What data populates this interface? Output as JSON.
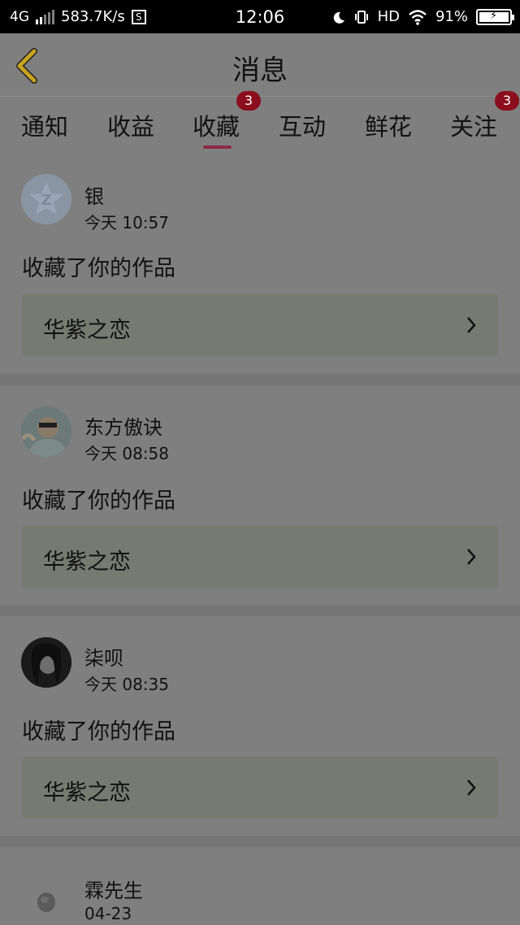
{
  "status_bar": {
    "network": "4G",
    "speed": "583.7K/s",
    "speed_icon": "S",
    "time": "12:06",
    "hd": "HD",
    "battery": "91%"
  },
  "header": {
    "title": "消息",
    "back_icon": "chevron-left-icon"
  },
  "tabs": [
    {
      "label": "通知"
    },
    {
      "label": "收益"
    },
    {
      "label": "收藏",
      "active": true,
      "badge": "3"
    },
    {
      "label": "互动"
    },
    {
      "label": "鲜花"
    },
    {
      "label": "关注",
      "badge": "3"
    }
  ],
  "messages": [
    {
      "user": "银",
      "time": "今天 10:57",
      "action": "收藏了你的作品",
      "work": "华紫之恋"
    },
    {
      "user": "东方傲诀",
      "time": "今天 08:58",
      "action": "收藏了你的作品",
      "work": "华紫之恋"
    },
    {
      "user": "柒呗",
      "time": "今天 08:35",
      "action": "收藏了你的作品",
      "work": "华紫之恋"
    },
    {
      "user": "霖先生",
      "time": "04-23"
    }
  ],
  "colors": {
    "accent": "#8c2a46",
    "badge": "#8b0e1e",
    "back_arrow": "#c6a21f",
    "overlay_bg": "#7f7f7f"
  }
}
